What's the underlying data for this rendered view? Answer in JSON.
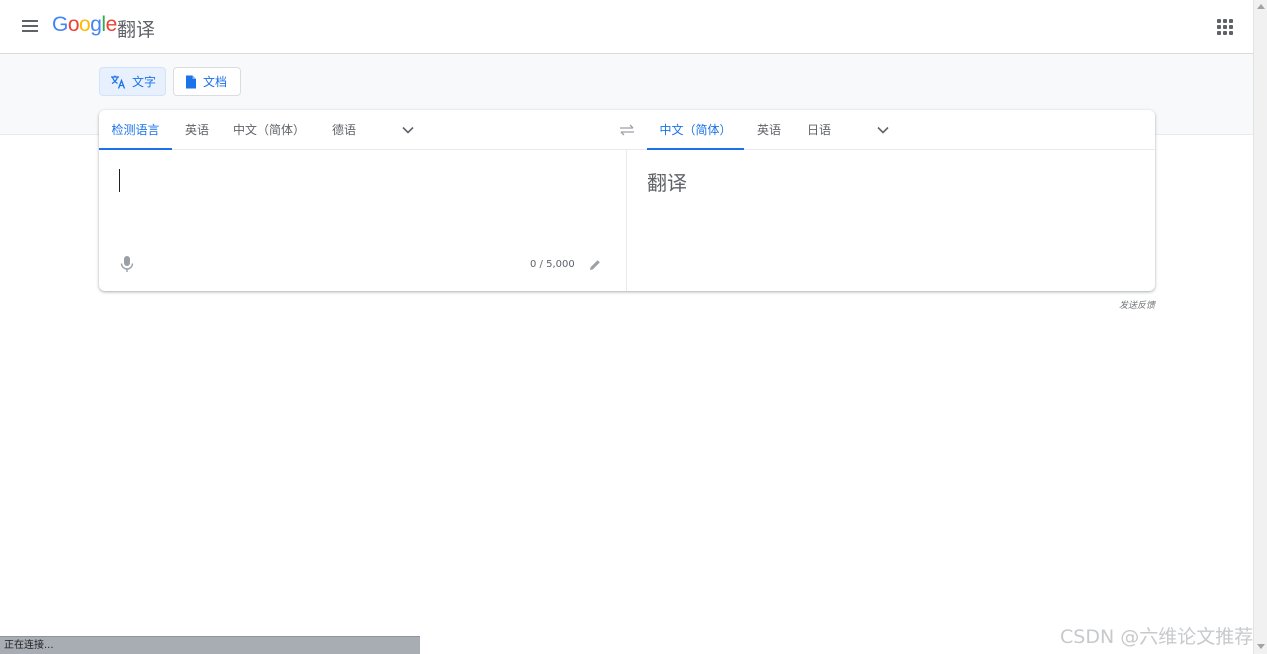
{
  "header": {
    "logo_parts": [
      "G",
      "o",
      "o",
      "g",
      "l",
      "e"
    ],
    "product": "翻译",
    "menu_icon": "hamburger-icon",
    "apps_icon": "apps-grid-icon"
  },
  "modes": [
    {
      "label": "文字",
      "icon": "translate-icon",
      "active": true
    },
    {
      "label": "文档",
      "icon": "document-icon",
      "active": false
    }
  ],
  "source": {
    "tabs": [
      "检测语言",
      "英语",
      "中文（简体）",
      "德语"
    ],
    "selected": "检测语言",
    "char_count": "0 / 5,000"
  },
  "target": {
    "tabs": [
      "中文（简体）",
      "英语",
      "日语"
    ],
    "selected": "中文（简体）",
    "placeholder": "翻译"
  },
  "feedback": "发送反馈",
  "status": "正在连接...",
  "watermark": "CSDN @六维论文推荐",
  "colors": {
    "accent": "#1a73e8",
    "text_muted": "#5f6368",
    "band": "#f8f9fa"
  }
}
